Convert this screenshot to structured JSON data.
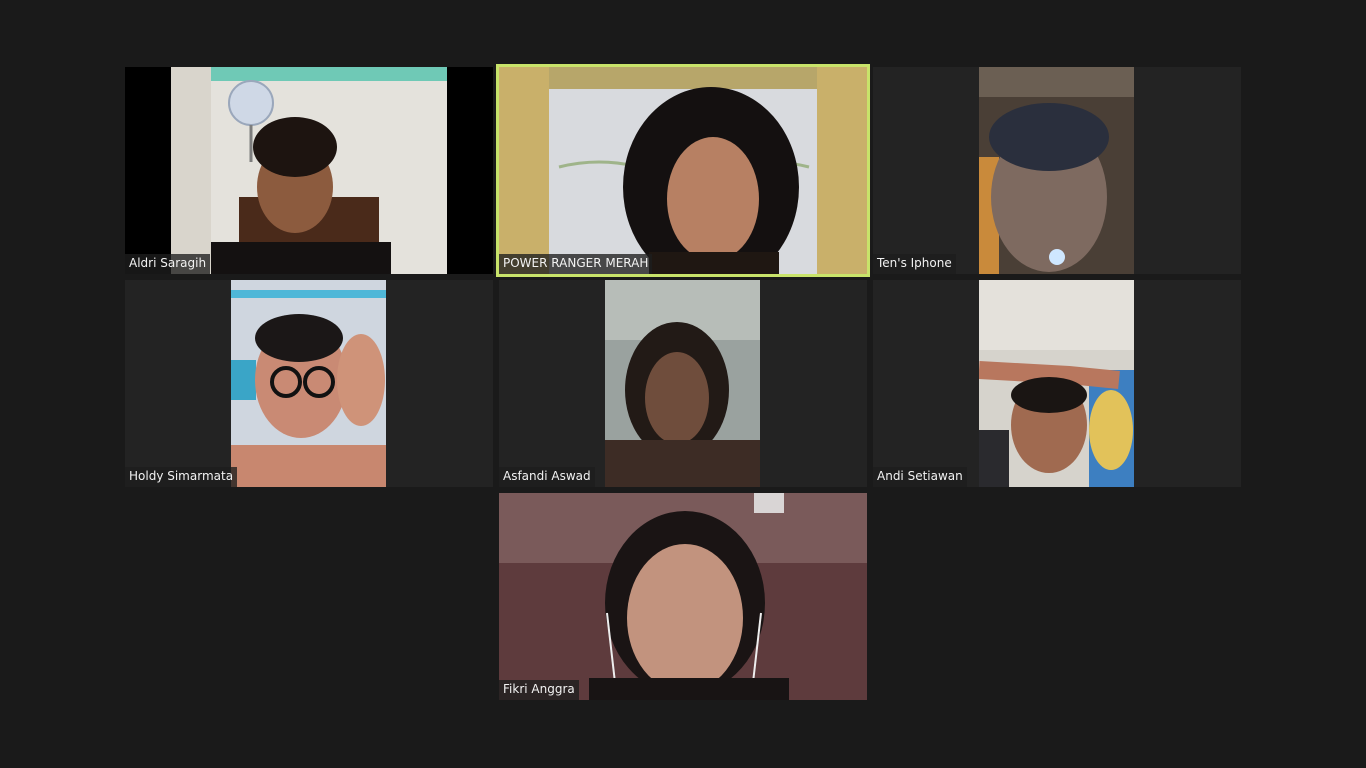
{
  "meeting": {
    "view": "gallery",
    "active_speaker": "POWER RANGER MERAH"
  },
  "participants": [
    {
      "name": "Aldri Saragih"
    },
    {
      "name": "POWER RANGER MERAH"
    },
    {
      "name": "Ten's Iphone"
    },
    {
      "name": "Holdy Simarmata"
    },
    {
      "name": "Asfandi Aswad"
    },
    {
      "name": "Andi Setiawan"
    },
    {
      "name": "Fikri Anggra"
    }
  ],
  "colors": {
    "background": "#1a1a1a",
    "tile_background": "#232323",
    "active_speaker_border": "#c8e36a",
    "label_text": "#f2f2f2"
  }
}
